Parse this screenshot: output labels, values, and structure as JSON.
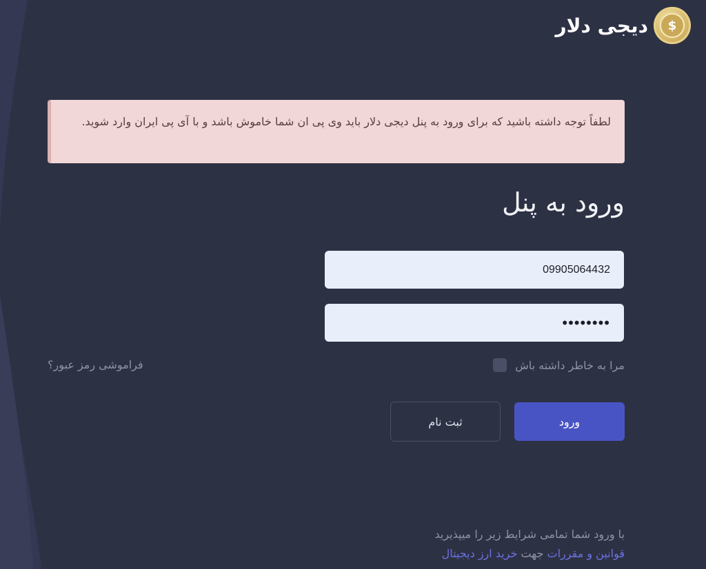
{
  "brand": {
    "logo_symbol": "$",
    "name": "دیجی دلار",
    "accent_color": "#d6b96a"
  },
  "alert": {
    "text": "لطفاً توجه داشته باشید که برای ورود به پنل دیجی دلار باید وی پی ان شما خاموش باشد و با آی پی ایران وارد شوید.",
    "background": "#f1d7d8"
  },
  "login": {
    "title": "ورود به پنل",
    "phone_value": "09905064432",
    "password_value": "••••••••",
    "remember_label": "مرا به خاطر داشته باش",
    "remember_checked": false,
    "forgot_label": "فراموشی رمز عبور؟",
    "login_button": "ورود",
    "register_button": "ثبت نام",
    "primary_color": "#4954c4"
  },
  "footer": {
    "line1": "با ورود شما تمامی شرایط زیر را میپذیرید",
    "terms_link": "قوانین و مقررات",
    "middle_text": "جهت",
    "buy_link": "خرید ارز دیجیتال"
  }
}
